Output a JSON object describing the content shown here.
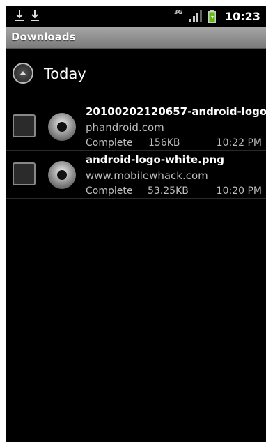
{
  "status_bar": {
    "network": "3G",
    "time": "10:23",
    "icons": [
      "download-icon",
      "download-icon",
      "network-3g-icon",
      "signal-icon",
      "battery-icon"
    ]
  },
  "title_bar": {
    "title": "Downloads"
  },
  "group": {
    "label": "Today",
    "icon": "collapse-arrow-icon"
  },
  "downloads": [
    {
      "title": "20100202120657-android-logo.",
      "source": "phandroid.com",
      "status": "Complete",
      "size": "156KB",
      "time": "10:22 PM"
    },
    {
      "title": "android-logo-white.png",
      "source": "www.mobilewhack.com",
      "status": "Complete",
      "size": "53.25KB",
      "time": "10:20 PM"
    }
  ],
  "colors": {
    "background": "#000000",
    "title_bar": "#8f8f8f",
    "primary_text": "#ffffff",
    "secondary_text": "#bdbdbd"
  }
}
